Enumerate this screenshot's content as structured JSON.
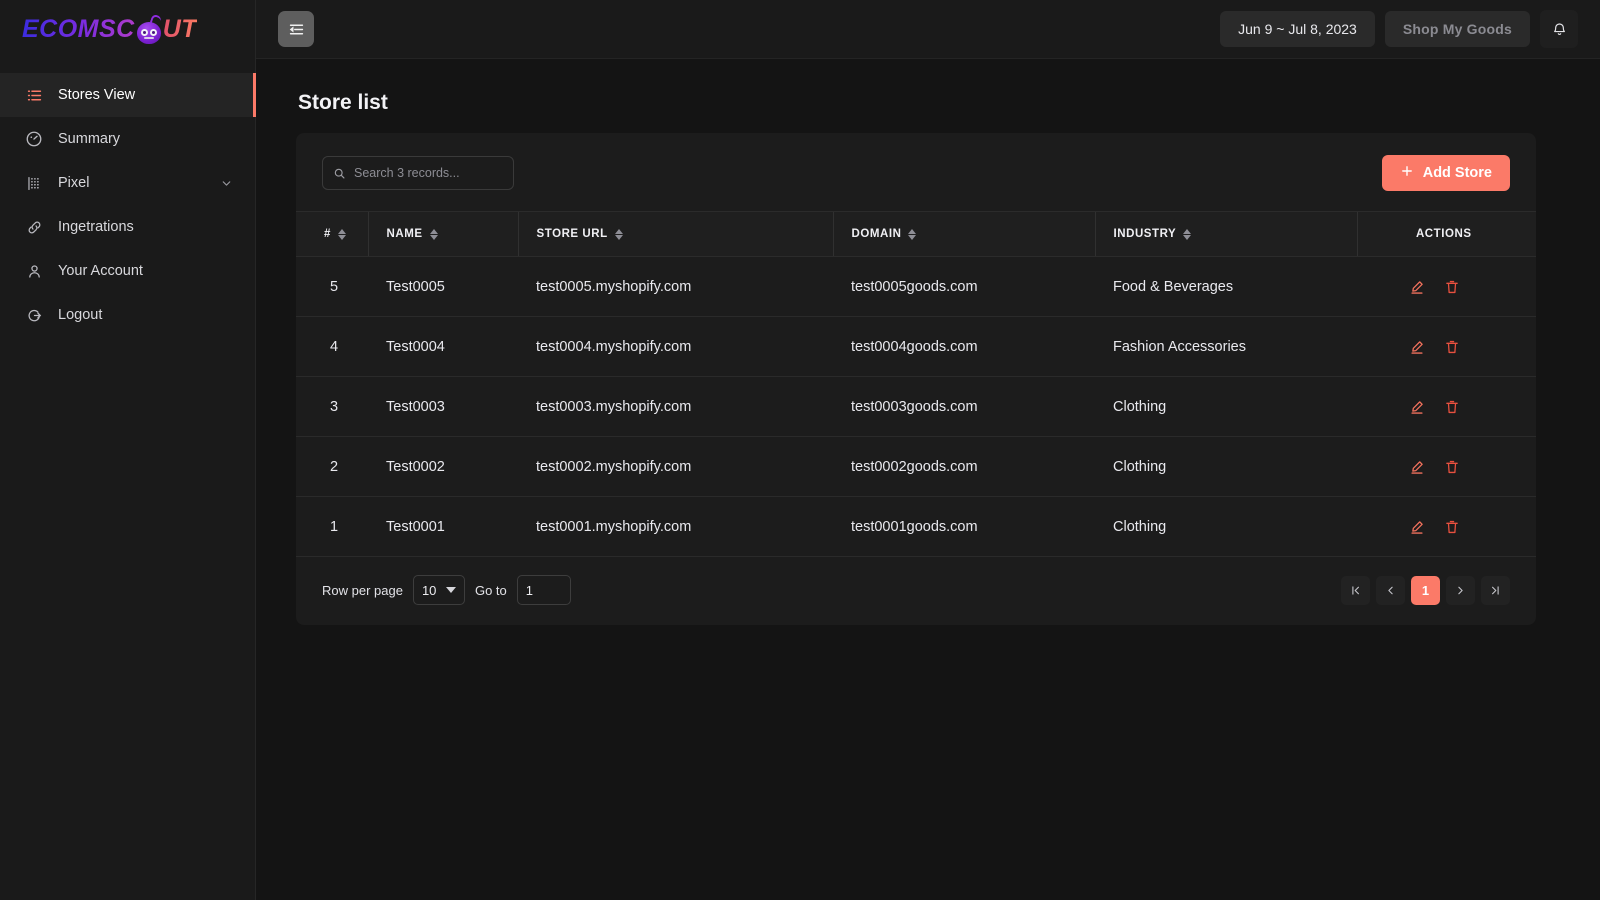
{
  "brand": {
    "name_part_a": "ECOMSC",
    "name_part_b": "UT",
    "logo_icon": "robot-head-icon"
  },
  "sidebar": {
    "items": [
      {
        "label": "Stores View",
        "icon": "list-icon",
        "active": true,
        "chevron": false
      },
      {
        "label": "Summary",
        "icon": "gauge-icon",
        "active": false,
        "chevron": false
      },
      {
        "label": "Pixel",
        "icon": "grid-dots-icon",
        "active": false,
        "chevron": true
      },
      {
        "label": "Ingetrations",
        "icon": "link-icon",
        "active": false,
        "chevron": false
      },
      {
        "label": "Your Account",
        "icon": "user-icon",
        "active": false,
        "chevron": false
      },
      {
        "label": "Logout",
        "icon": "logout-icon",
        "active": false,
        "chevron": false
      }
    ]
  },
  "topbar": {
    "menu_icon": "menu-collapse-icon",
    "date_range": "Jun 9 ~ Jul 8, 2023",
    "shop_label": "Shop My Goods",
    "notification_icon": "bell-icon"
  },
  "page": {
    "title": "Store list"
  },
  "toolbar": {
    "search_placeholder": "Search 3 records...",
    "search_value": "",
    "search_icon": "search-icon",
    "add_label": "Add Store",
    "add_icon": "plus-icon"
  },
  "table": {
    "columns": [
      {
        "label": "#",
        "sortable": true
      },
      {
        "label": "NAME",
        "sortable": true
      },
      {
        "label": "STORE URL",
        "sortable": true
      },
      {
        "label": "DOMAIN",
        "sortable": true
      },
      {
        "label": "INDUSTRY",
        "sortable": true
      },
      {
        "label": "ACTIONS",
        "sortable": false
      }
    ],
    "rows": [
      {
        "idx": "5",
        "name": "Test0005",
        "url": "test0005.myshopify.com",
        "domain": "test0005goods.com",
        "industry": "Food & Beverages"
      },
      {
        "idx": "4",
        "name": "Test0004",
        "url": "test0004.myshopify.com",
        "domain": "test0004goods.com",
        "industry": "Fashion Accessories"
      },
      {
        "idx": "3",
        "name": "Test0003",
        "url": "test0003.myshopify.com",
        "domain": "test0003goods.com",
        "industry": "Clothing"
      },
      {
        "idx": "2",
        "name": "Test0002",
        "url": "test0002.myshopify.com",
        "domain": "test0002goods.com",
        "industry": "Clothing"
      },
      {
        "idx": "1",
        "name": "Test0001",
        "url": "test0001.myshopify.com",
        "domain": "test0001goods.com",
        "industry": "Clothing"
      }
    ],
    "row_actions": {
      "edit_icon": "pencil-icon",
      "delete_icon": "trash-icon"
    }
  },
  "pagination": {
    "rows_per_page_label": "Row per page",
    "rows_per_page_value": "10",
    "goto_label": "Go to",
    "goto_value": "1",
    "first_icon": "first-page-icon",
    "prev_icon": "chevron-left-icon",
    "current_page": "1",
    "next_icon": "chevron-right-icon",
    "last_icon": "last-page-icon"
  },
  "colors": {
    "accent": "#fb7a68",
    "page_bg": "#141414",
    "panel_bg": "#1a1a1a",
    "card_bg": "#1c1c1c",
    "header_row_bg": "#1f1f1f",
    "text_primary": "#f0f0f4",
    "text_muted": "#8d8d94",
    "danger": "#e8503f"
  }
}
